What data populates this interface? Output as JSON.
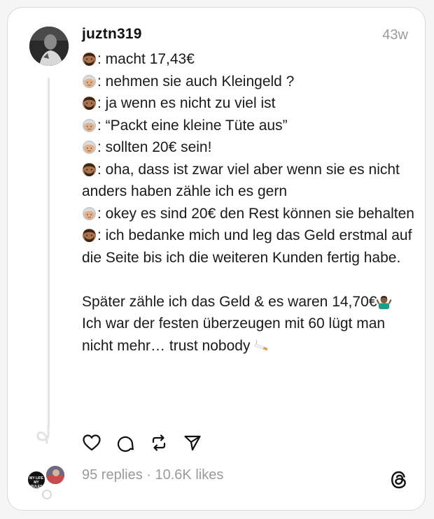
{
  "post": {
    "username": "juztn319",
    "timestamp": "43w",
    "lines": [
      {
        "speaker": "man",
        "text": ": macht 17,43€"
      },
      {
        "speaker": "old",
        "text": ": nehmen sie auch Kleingeld ?"
      },
      {
        "speaker": "man",
        "text": ": ja wenn es nicht zu viel ist"
      },
      {
        "speaker": "old",
        "text": ": “Packt eine kleine Tüte aus”"
      },
      {
        "speaker": "old",
        "text": ": sollten 20€ sein!"
      },
      {
        "speaker": "man",
        "text": ": oha, dass ist zwar viel aber wenn sie es nicht anders haben zähle ich es gern"
      },
      {
        "speaker": "old",
        "text": ": okey es sind 20€ den Rest können sie behalten"
      },
      {
        "speaker": "man",
        "text": ": ich bedanke mich und leg das Geld erstmal auf die Seite bis ich die weiteren Kunden fertig habe."
      },
      {
        "speaker": "",
        "text": ""
      },
      {
        "speaker": "",
        "text": "Später zähle ich das Geld & es waren 14,70€",
        "trailing_emoji": "shrug"
      },
      {
        "speaker": "",
        "text": "Ich war der festen überzeugen mit 60 lügt man nicht mehr… trust nobody ",
        "trailing_emoji": "cigarette"
      }
    ]
  },
  "actions": {
    "like_icon": "heart-icon",
    "reply_icon": "comment-icon",
    "repost_icon": "repost-icon",
    "share_icon": "send-icon"
  },
  "stats": {
    "text": "95 replies · 10.6K likes"
  },
  "mini_avatar_label": "MY LIFE MY RULES",
  "colors": {
    "text": "#1a1a1a",
    "muted": "#9a9a9a",
    "border": "#d9d9d9"
  }
}
